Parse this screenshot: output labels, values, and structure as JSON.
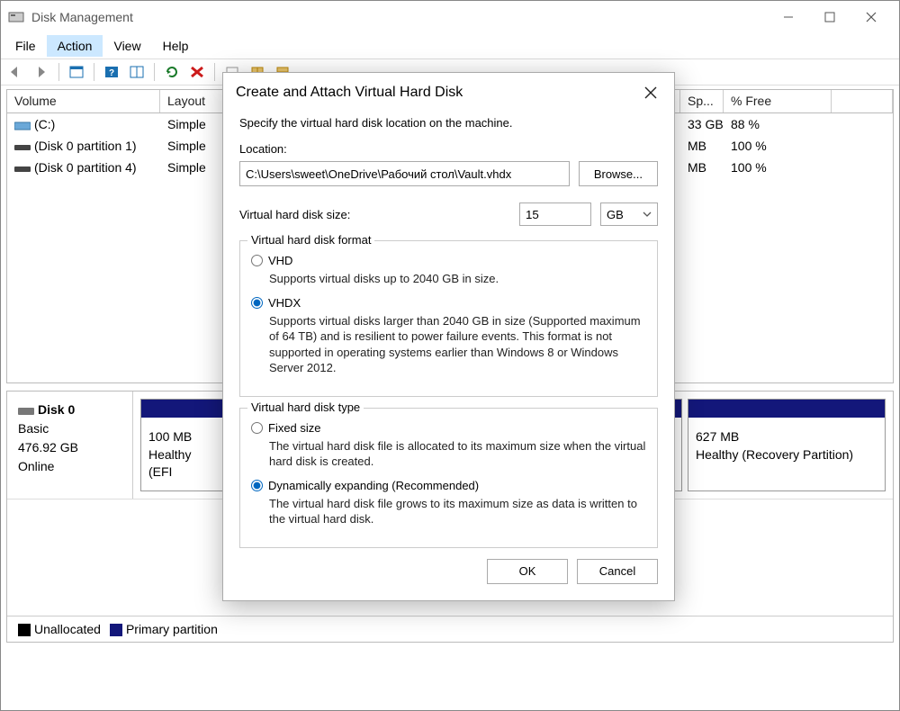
{
  "window": {
    "title": "Disk Management"
  },
  "menu": {
    "file": "File",
    "action": "Action",
    "view": "View",
    "help": "Help"
  },
  "columns": {
    "volume": "Volume",
    "layout": "Layout",
    "capacity": "Sp...",
    "free": "% Free"
  },
  "volumes": [
    {
      "name": "(C:)",
      "layout": "Simple",
      "capacity": "33 GB",
      "free": "88 %"
    },
    {
      "name": "(Disk 0 partition 1)",
      "layout": "Simple",
      "capacity": "MB",
      "free": "100 %"
    },
    {
      "name": "(Disk 0 partition 4)",
      "layout": "Simple",
      "capacity": "MB",
      "free": "100 %"
    }
  ],
  "disk": {
    "name": "Disk 0",
    "type": "Basic",
    "size": "476.92 GB",
    "status": "Online",
    "parts": [
      {
        "size": "100 MB",
        "status": "Healthy (EFI"
      },
      {
        "size": "627 MB",
        "status": "Healthy (Recovery Partition)"
      }
    ]
  },
  "legend": {
    "unallocated": "Unallocated",
    "primary": "Primary partition"
  },
  "dialog": {
    "title": "Create and Attach Virtual Hard Disk",
    "subtitle": "Specify the virtual hard disk location on the machine.",
    "location_label": "Location:",
    "location_value": "C:\\Users\\sweet\\OneDrive\\Рабочий стол\\Vault.vhdx",
    "browse": "Browse...",
    "size_label": "Virtual hard disk size:",
    "size_value": "15",
    "size_unit": "GB",
    "format_group": "Virtual hard disk format",
    "format_vhd": "VHD",
    "format_vhd_desc": "Supports virtual disks up to 2040 GB in size.",
    "format_vhdx": "VHDX",
    "format_vhdx_desc": "Supports virtual disks larger than 2040 GB in size (Supported maximum of 64 TB) and is resilient to power failure events. This format is not supported in operating systems earlier than Windows 8 or Windows Server 2012.",
    "type_group": "Virtual hard disk type",
    "type_fixed": "Fixed size",
    "type_fixed_desc": "The virtual hard disk file is allocated to its maximum size when the virtual hard disk is created.",
    "type_dynamic": "Dynamically expanding (Recommended)",
    "type_dynamic_desc": "The virtual hard disk file grows to its maximum size as data is written to the virtual hard disk.",
    "ok": "OK",
    "cancel": "Cancel"
  }
}
